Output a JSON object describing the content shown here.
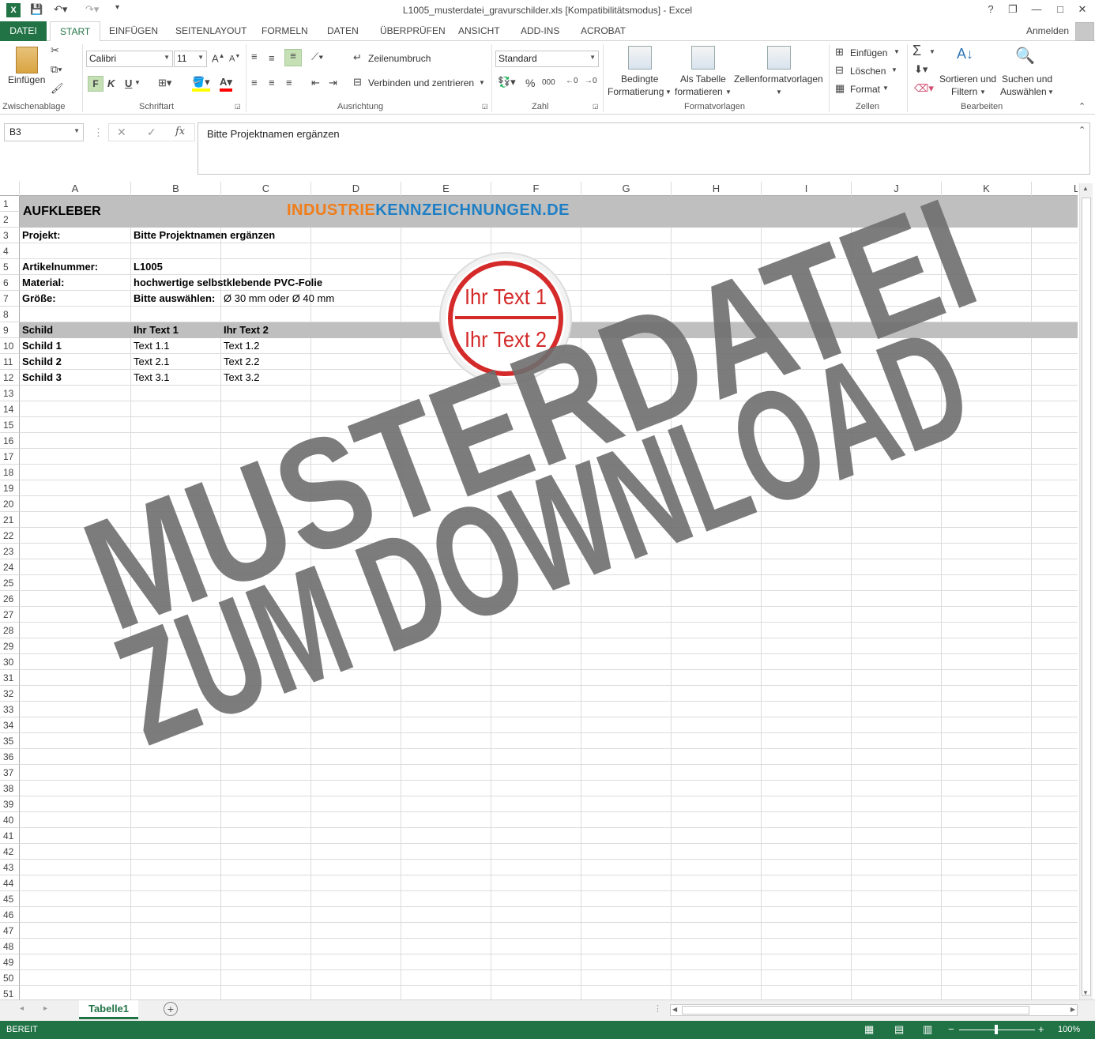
{
  "window": {
    "title": "L1005_musterdatei_gravurschilder.xls  [Kompatibilitätsmodus] - Excel",
    "help": "?",
    "minimize": "—",
    "restore": "❐",
    "close": "✕"
  },
  "tabs": {
    "file": "DATEI",
    "items": [
      "START",
      "EINFÜGEN",
      "SEITENLAYOUT",
      "FORMELN",
      "DATEN",
      "ÜBERPRÜFEN",
      "ANSICHT",
      "ADD-INS",
      "ACROBAT"
    ],
    "account": "Anmelden"
  },
  "ribbon": {
    "clipboard": {
      "paste": "Einfügen",
      "label": "Zwischenablage"
    },
    "font": {
      "name": "Calibri",
      "size": "11",
      "bold": "F",
      "italic": "K",
      "underline": "U",
      "label": "Schriftart"
    },
    "alignment": {
      "wrap": "Zeilenumbruch",
      "merge": "Verbinden und zentrieren",
      "label": "Ausrichtung"
    },
    "number": {
      "format": "Standard",
      "percent": "%",
      "thousands": "000",
      "label": "Zahl"
    },
    "styles": {
      "conditional_1": "Bedingte",
      "conditional_2": "Formatierung",
      "table_1": "Als Tabelle",
      "table_2": "formatieren",
      "cell_styles": "Zellenformatvorlagen",
      "label": "Formatvorlagen"
    },
    "cells": {
      "insert": "Einfügen",
      "delete": "Löschen",
      "format": "Format",
      "label": "Zellen"
    },
    "editing": {
      "sort_1": "Sortieren und",
      "sort_2": "Filtern",
      "find_1": "Suchen und",
      "find_2": "Auswählen",
      "label": "Bearbeiten"
    }
  },
  "formula_bar": {
    "name_box": "B3",
    "fx": "fx",
    "content": "Bitte Projektnamen ergänzen"
  },
  "columns": [
    "A",
    "B",
    "C",
    "D",
    "E",
    "F",
    "G",
    "H",
    "I",
    "J",
    "K",
    "L"
  ],
  "sheet": {
    "a1": "AUFKLEBER",
    "logo_part1": "INDUSTRIE",
    "logo_part2": "KENNZEICHNUNGEN.DE",
    "a3": "Projekt:",
    "b3": "Bitte Projektnamen ergänzen",
    "a5": "Artikelnummer:",
    "b5": "L1005",
    "a6": "Material:",
    "b6": "hochwertige selbstklebende PVC-Folie",
    "a7": "Größe:",
    "b7": "Bitte auswählen:",
    "c7": "Ø 30 mm oder Ø 40 mm",
    "a9": "Schild",
    "b9": "Ihr Text 1",
    "c9": "Ihr Text 2",
    "a10": "Schild 1",
    "b10": "Text 1.1",
    "c10": "Text 1.2",
    "a11": "Schild 2",
    "b11": "Text 2.1",
    "c11": "Text 2.2",
    "a12": "Schild 3",
    "b12": "Text 3.1",
    "c12": "Text 3.2"
  },
  "stamp": {
    "line1": "Ihr Text 1",
    "line2": "Ihr Text 2",
    "color": "#d42a2a"
  },
  "watermark": {
    "line1": "MUSTERDATEI",
    "line2": "ZUM DOWNLOAD"
  },
  "sheet_tabs": {
    "active": "Tabelle1"
  },
  "status": {
    "ready": "BEREIT",
    "zoom": "100%"
  },
  "colors": {
    "accent": "#217346",
    "logo_orange": "#f07d1a",
    "logo_blue": "#1f7fc4",
    "band": "#bfbfbf"
  }
}
